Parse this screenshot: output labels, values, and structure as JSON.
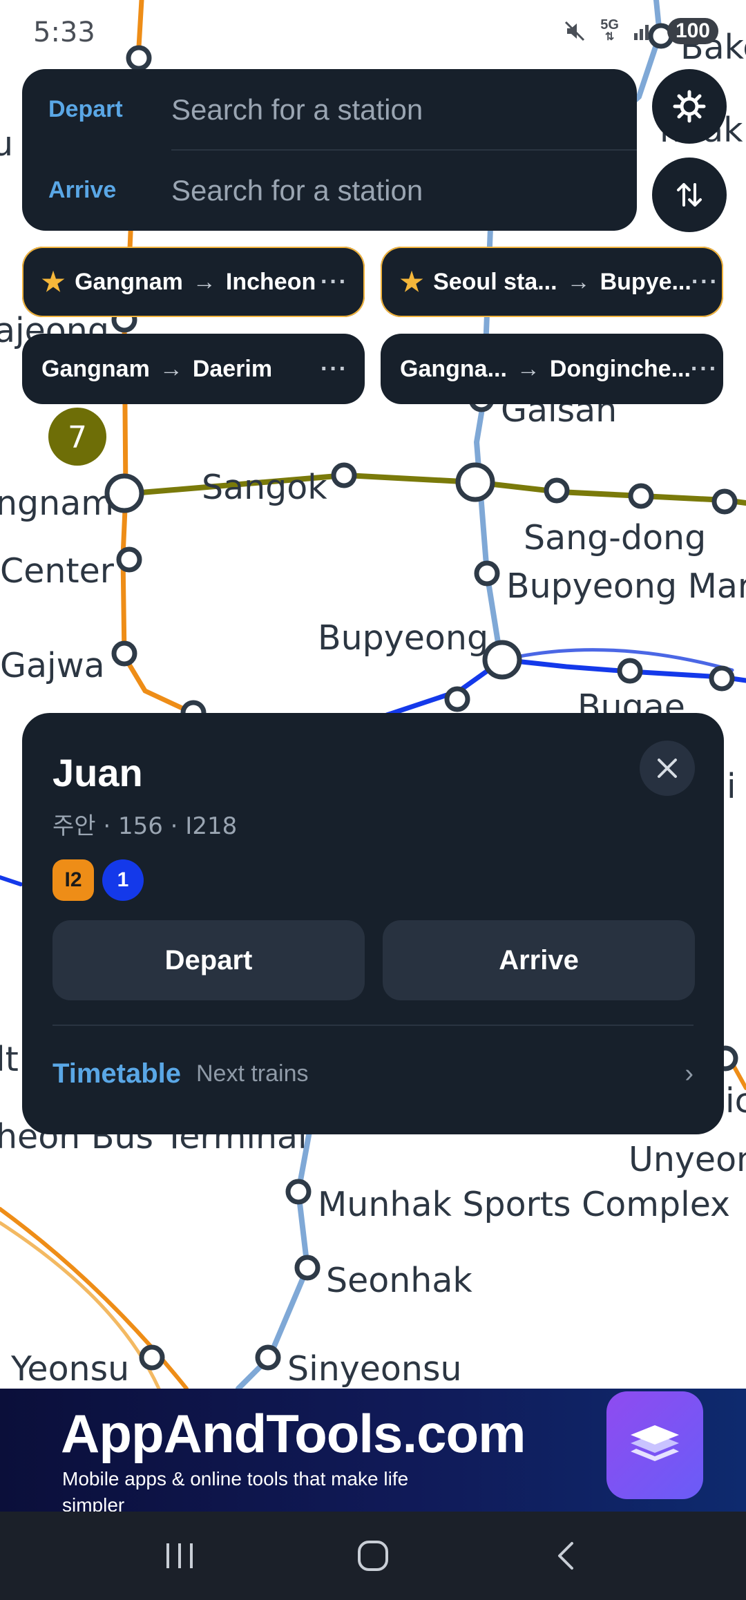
{
  "status_bar": {
    "time": "5:33",
    "network": "5G",
    "battery": "100",
    "icons": [
      "mute-icon",
      "network-5g-icon",
      "signal-icon",
      "battery-icon"
    ]
  },
  "search": {
    "depart_label": "Depart",
    "arrive_label": "Arrive",
    "depart_placeholder": "Search for a station",
    "arrive_placeholder": "Search for a station",
    "settings_icon": "gear-icon",
    "swap_icon": "swap-icon"
  },
  "route_chips": [
    {
      "favorite": true,
      "from": "Gangnam",
      "to": "Incheon",
      "menu": "···"
    },
    {
      "favorite": true,
      "from": "Seoul sta...",
      "to": "Bupye...",
      "menu": "···"
    },
    {
      "favorite": false,
      "from": "Gangnam",
      "to": "Daerim",
      "menu": "···"
    },
    {
      "favorite": false,
      "from": "Gangna...",
      "to": "Donginche...",
      "menu": "···"
    }
  ],
  "chip_arrow": "→",
  "chip_star": "★",
  "map": {
    "line_badge": "7",
    "stations": [
      "Bake",
      "nhak",
      "ti",
      "u",
      "ajeong",
      "Gaisan",
      "ngnam",
      "Sangok",
      "Center",
      "Sang-dong",
      "Bupyeong Mar",
      "Gajwa",
      "Bupyeong",
      "Bugae",
      "i",
      "lt",
      "ic",
      "heon Bus Terminal",
      "Unyeon",
      "Munhak Sports Complex",
      "Seonhak",
      "Yeonsu",
      "Sinyeonsu"
    ],
    "colors": {
      "line_orange": "#EE8D17",
      "line_olive": "#7A7A0A",
      "line_lightblue": "#7FA8D6",
      "line_blue": "#1439EA",
      "badge_olive": "#6E6E07"
    }
  },
  "station_card": {
    "name": "Juan",
    "subtitle": "주안 · 156 · I218",
    "lines": [
      {
        "label": "I2",
        "color": "#EE8D17"
      },
      {
        "label": "1",
        "color": "#1439EA"
      }
    ],
    "depart_button": "Depart",
    "arrive_button": "Arrive",
    "timetable_label": "Timetable",
    "timetable_sub": "Next trains",
    "chevron": "›"
  },
  "ad": {
    "title": "AppAndTools.com",
    "subtitle": "Mobile apps & online tools that make life simpler"
  },
  "nav_bar": {
    "recent_icon": "recent-apps-icon",
    "home_icon": "home-icon",
    "back_icon": "back-icon"
  }
}
